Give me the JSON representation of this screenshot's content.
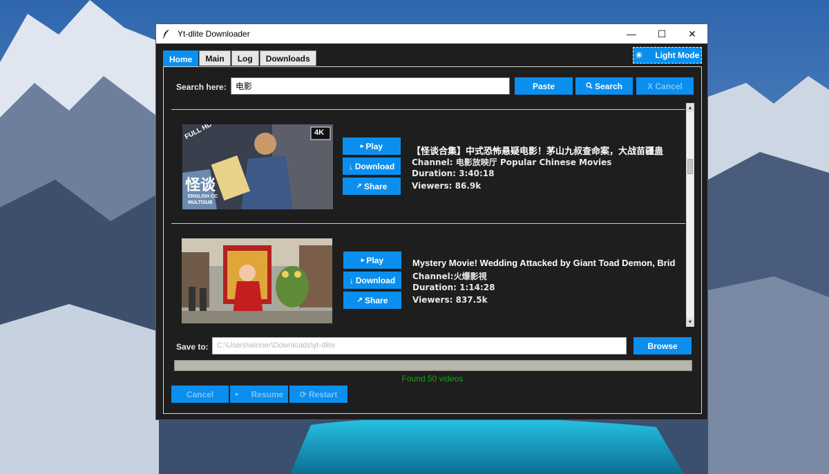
{
  "window": {
    "title": "Yt-dlite Downloader",
    "controls": {
      "minimize": "—",
      "maximize": "☐",
      "close": "✕"
    }
  },
  "tabs": [
    {
      "label": "Home",
      "active": true
    },
    {
      "label": "Main",
      "active": false
    },
    {
      "label": "Log",
      "active": false
    },
    {
      "label": "Downloads",
      "active": false
    }
  ],
  "theme_toggle": {
    "icon": "☀",
    "label": "Light Mode"
  },
  "search": {
    "label": "Search here:",
    "value": "电影",
    "paste_label": "Paste",
    "search_icon": "🔍",
    "search_label": "Search",
    "cancel_label": "X Cancel"
  },
  "results": [
    {
      "thumb_badges": [
        "FULL HD",
        "4K",
        "怪谈",
        "ENGLISH CC",
        "MULTISUB"
      ],
      "title": "【怪谈合集】中式恐怖悬疑电影！茅山九叔查命案，大战苗疆蛊",
      "channel_label": "Channel:",
      "channel": "电影放映厅 Popular Chinese Movies",
      "duration_label": "Duration:",
      "duration": "3:40:18",
      "viewers_label": "Viewers:",
      "viewers": "86.9k"
    },
    {
      "thumb_badges": [],
      "title": "Mystery Movie! Wedding Attacked by Giant Toad Demon, Bride",
      "channel_label": "Channel:",
      "channel": "火爆影視",
      "duration_label": "Duration:",
      "duration": "1:14:28",
      "viewers_label": "Viewers:",
      "viewers": "837.5k"
    }
  ],
  "item_buttons": {
    "play_icon": "▸",
    "play": "Play",
    "download_icon": "↓",
    "download": "Download",
    "share_icon": "↗",
    "share": "Share"
  },
  "save": {
    "label": "Save to:",
    "placeholder": "C:\\Users\\winner\\Downloads\\yt-dlite",
    "browse_label": "Browse"
  },
  "progress": {
    "value": 0
  },
  "status": "Found 50 videos",
  "bottom_buttons": {
    "cancel": "Cancel",
    "resume_icon": "▸",
    "resume": "Resume",
    "restart_icon": "⟳",
    "restart": "Restart"
  },
  "colors": {
    "accent": "#0b8fef",
    "window_bg": "#1e1e1e",
    "status_green": "#19a319"
  }
}
